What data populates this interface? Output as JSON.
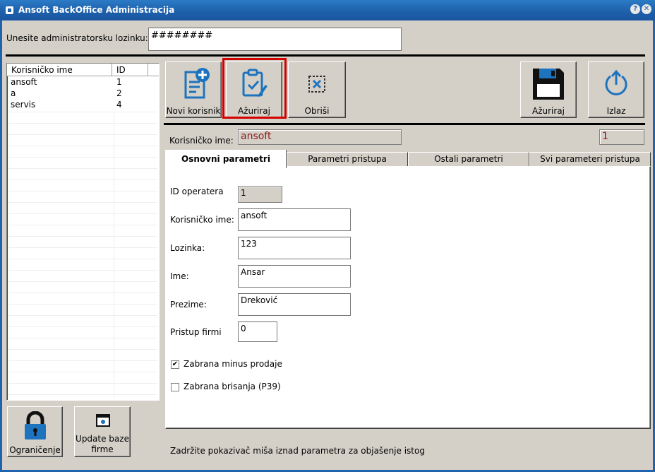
{
  "window": {
    "title": "Ansoft BackOffice Administracija",
    "help_label": "?",
    "close_label": "✕"
  },
  "password": {
    "label": "Unesite administratorsku lozinku:",
    "value": "########"
  },
  "user_list": {
    "columns": [
      "Korisničko ime",
      "ID"
    ],
    "rows": [
      {
        "name": "ansoft",
        "id": "1"
      },
      {
        "name": "a",
        "id": "2"
      },
      {
        "name": "servis",
        "id": "4"
      }
    ]
  },
  "toolbar": {
    "new_user": "Novi korisnik",
    "update": "Ažuriraj",
    "delete": "Obriši",
    "save": "Ažuriraj",
    "exit": "Izlaz"
  },
  "selected": {
    "username_label": "Korisničko ime:",
    "username": "ansoft",
    "id": "1"
  },
  "tabs": [
    "Osnovni parametri",
    "Parametri pristupa",
    "Ostali parametri",
    "Svi parameteri pristupa"
  ],
  "form": {
    "operator_id_label": "ID operatera",
    "operator_id": "1",
    "username_label": "Korisničko ime:",
    "username": "ansoft",
    "password_label": "Lozinka:",
    "password": "123",
    "first_name_label": "Ime:",
    "first_name": "Ansar",
    "last_name_label": "Prezime:",
    "last_name": "Dreković",
    "company_access_label": "Pristup firmi",
    "company_access": "0",
    "minus_sale_label": "Zabrana minus prodaje",
    "minus_sale_checked": true,
    "delete_ban_label": "Zabrana brisanja (P39)",
    "delete_ban_checked": false
  },
  "bottom": {
    "restrictions": "Ograničenje",
    "update_db_line1": "Update baze",
    "update_db_line2": "firme",
    "hint": "Zadržite pokazivač miša iznad parametra za objašenje istog"
  },
  "colors": {
    "titlebar": "#1f62ad",
    "icon_blue": "#1e73be",
    "highlight": "#d40000",
    "disabled_text": "#8b1a1a"
  }
}
